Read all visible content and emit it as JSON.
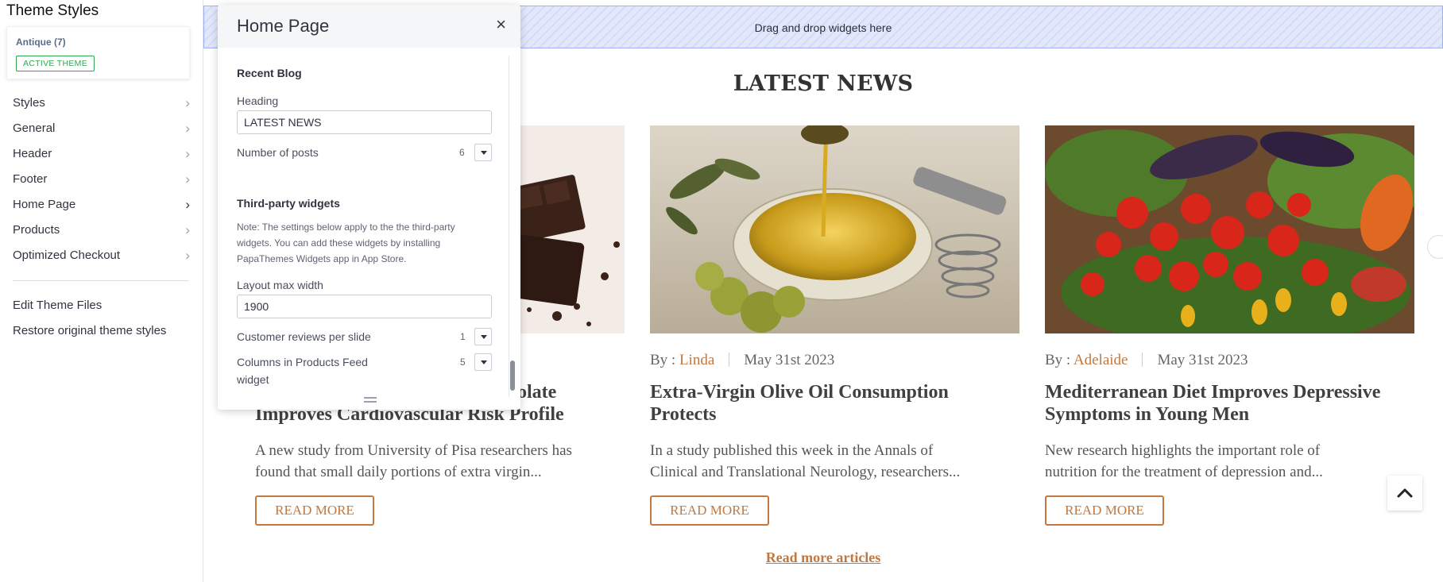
{
  "sidebar": {
    "title": "Theme Styles",
    "theme_card": {
      "name": "Antique (7)",
      "badge": "ACTIVE THEME"
    },
    "nav_items": [
      {
        "label": "Styles"
      },
      {
        "label": "General"
      },
      {
        "label": "Header"
      },
      {
        "label": "Footer"
      },
      {
        "label": "Home Page",
        "active": true
      },
      {
        "label": "Products"
      },
      {
        "label": "Optimized Checkout"
      }
    ],
    "links": {
      "edit_files": "Edit Theme Files",
      "restore": "Restore original theme styles"
    },
    "chevron_glyph": "›"
  },
  "panel": {
    "title": "Home Page",
    "close_glyph": "×",
    "recent_blog": {
      "section": "Recent Blog",
      "heading_label": "Heading",
      "heading_value": "LATEST NEWS",
      "posts_label": "Number of posts",
      "posts_value": "6"
    },
    "third_party": {
      "section": "Third-party widgets",
      "note": "Note: The settings below apply to the the third-party widgets. You can add these widgets by installing PapaThemes Widgets app in App Store.",
      "layout_label": "Layout max width",
      "layout_value": "1900",
      "reviews_label": "Customer reviews per slide",
      "reviews_value": "1",
      "columns_label_line1": "Columns in Products Feed",
      "columns_label_line2": "widget",
      "columns_value": "5"
    }
  },
  "preview": {
    "dropzone": "Drag and drop widgets here",
    "heading": "LATEST NEWS",
    "author_prefix": "By :",
    "read_more_button": "READ MORE",
    "read_more_articles": "Read more articles",
    "articles": [
      {
        "author": "",
        "date": "",
        "title_line1": "Cocoa and Chocolate",
        "title_visible_line1": "olate",
        "title_line2": "Improves Cardiovascular Risk Profile",
        "desc_line1": "A new study from University of Pisa researchers has",
        "desc_line2": "found that small daily portions of extra virgin..."
      },
      {
        "author": "Linda",
        "date": "May 31st 2023",
        "title_line1": "Extra-Virgin Olive Oil Consumption",
        "title_line2": "Protects",
        "desc_line1": "In a study published this week in the Annals of",
        "desc_line2": "Clinical and Translational Neurology, researchers..."
      },
      {
        "author": "Adelaide",
        "date": "May 31st 2023",
        "title_line1": "Mediterranean Diet Improves Depressive",
        "title_line2": "Symptoms in Young Men",
        "desc_line1": "New research highlights the important role of",
        "desc_line2": "nutrition for the treatment of depression and..."
      }
    ]
  },
  "colors": {
    "accent": "#c2783e",
    "active_badge": "#2fa84f",
    "dropzone": "#d3dbf7"
  }
}
